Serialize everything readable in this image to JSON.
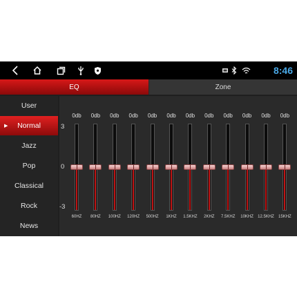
{
  "statusbar": {
    "time": "8:46",
    "icons": [
      "back-icon",
      "home-icon",
      "recents-icon",
      "usb-icon",
      "shield-icon",
      "sd-card-icon",
      "bluetooth-icon",
      "wifi-icon"
    ]
  },
  "tabs": [
    {
      "label": "EQ",
      "active": true
    },
    {
      "label": "Zone",
      "active": false
    }
  ],
  "presets": [
    {
      "label": "User",
      "active": false
    },
    {
      "label": "Normal",
      "active": true
    },
    {
      "label": "Jazz",
      "active": false
    },
    {
      "label": "Pop",
      "active": false
    },
    {
      "label": "Classical",
      "active": false
    },
    {
      "label": "Rock",
      "active": false
    },
    {
      "label": "News",
      "active": false
    }
  ],
  "scale": {
    "max": "3",
    "mid": "0",
    "min": "-3"
  },
  "bands": [
    {
      "freq": "60HZ",
      "db_label": "0db",
      "value": 0
    },
    {
      "freq": "80HZ",
      "db_label": "0db",
      "value": 0
    },
    {
      "freq": "100HZ",
      "db_label": "0db",
      "value": 0
    },
    {
      "freq": "120HZ",
      "db_label": "0db",
      "value": 0
    },
    {
      "freq": "500HZ",
      "db_label": "0db",
      "value": 0
    },
    {
      "freq": "1KHZ",
      "db_label": "0db",
      "value": 0
    },
    {
      "freq": "1.5KHZ",
      "db_label": "0db",
      "value": 0
    },
    {
      "freq": "2KHZ",
      "db_label": "0db",
      "value": 0
    },
    {
      "freq": "7.5KHZ",
      "db_label": "0db",
      "value": 0
    },
    {
      "freq": "10KHZ",
      "db_label": "0db",
      "value": 0
    },
    {
      "freq": "12.5KHZ",
      "db_label": "0db",
      "value": 0
    },
    {
      "freq": "15KHZ",
      "db_label": "0db",
      "value": 0
    }
  ],
  "colors": {
    "accent": "#d71818",
    "time": "#4aa8e6"
  }
}
